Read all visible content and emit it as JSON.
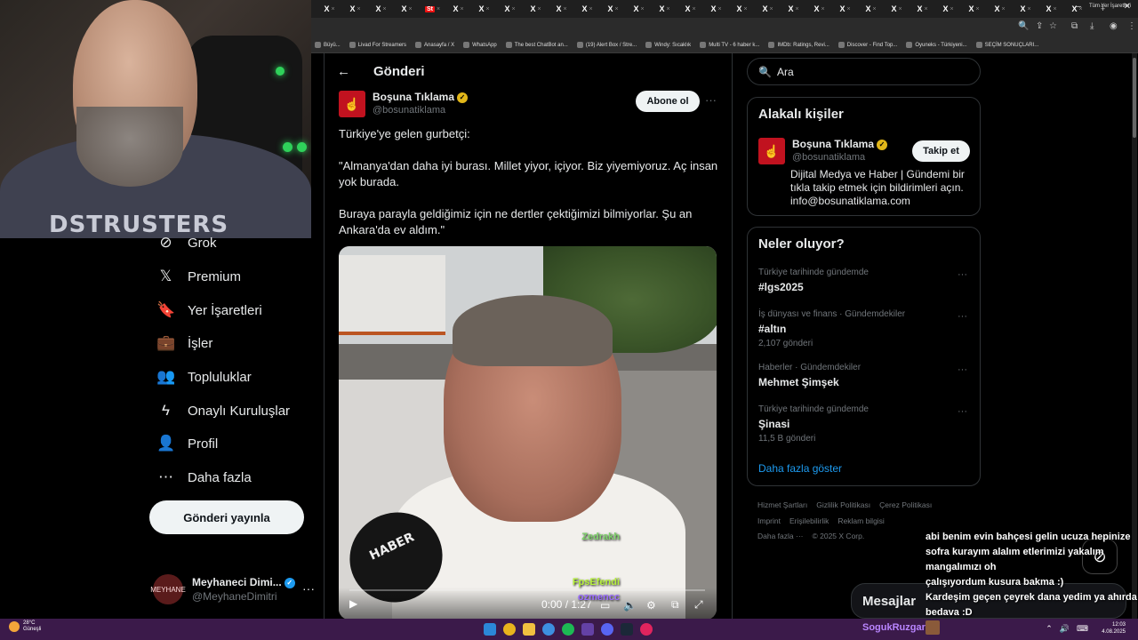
{
  "browser": {
    "tab_icon": "X",
    "tab_close": "×",
    "active_tab_label": "St",
    "new_tab": "+",
    "bookmarks": [
      "Büyü...",
      "Livad For Streamers",
      "Anasayfa / X",
      "WhatsApp",
      "The best ChatBot an...",
      "(19) Alert Box / Stre...",
      "Windy: Sıcaklık",
      "Multi TV - 6 haber k...",
      "IMDb: Ratings, Revi...",
      "Discover - Find Top...",
      "Oyuneks - Türkiyeni...",
      "SEÇİM SONUÇLARI..."
    ],
    "all_bookmarks": "Tüm Yer İşaretleri"
  },
  "webcam": {
    "shirt_text": "DSTRUSTERS"
  },
  "sidebar": {
    "items": [
      {
        "label": "Grok",
        "icon": "grok-icon",
        "glyph": "⊘"
      },
      {
        "label": "Premium",
        "icon": "x-logo-icon",
        "glyph": "𝕏"
      },
      {
        "label": "Yer İşaretleri",
        "icon": "bookmark-icon",
        "glyph": "🔖"
      },
      {
        "label": "İşler",
        "icon": "briefcase-icon",
        "glyph": "💼"
      },
      {
        "label": "Topluluklar",
        "icon": "communities-icon",
        "glyph": "👥"
      },
      {
        "label": "Onaylı Kuruluşlar",
        "icon": "lightning-icon",
        "glyph": "ϟ"
      },
      {
        "label": "Profil",
        "icon": "person-icon",
        "glyph": "👤"
      },
      {
        "label": "Daha fazla",
        "icon": "more-circle-icon",
        "glyph": "⋯"
      }
    ],
    "post_button": "Gönderi yayınla",
    "account": {
      "name": "Meyhaneci Dimi...",
      "handle": "@MeyhaneDimitri",
      "avatar_text": "MEYHANE"
    }
  },
  "post": {
    "header_title": "Gönderi",
    "author_name": "Boşuna Tıklama",
    "author_handle": "@bosunatiklama",
    "subscribe_label": "Abone ol",
    "paragraphs": [
      "Türkiye'ye gelen gurbetçi:",
      "\"Almanya'dan daha iyi burası. Millet yiyor, içiyor. Biz yiyemiyoruz. Aç insan yok burada.",
      "Buraya parayla geldiğimiz için ne dertler çektiğimizi bilmiyorlar. Şu an Ankara'da ev aldım.\""
    ],
    "video": {
      "time": "0:00 / 1:27",
      "mic_label": "HABER",
      "progress": 0
    }
  },
  "right": {
    "search_placeholder": "Ara",
    "relevant_title": "Alakalı kişiler",
    "relevant_person": {
      "name": "Boşuna Tıklama",
      "handle": "@bosunatiklama",
      "bio": "Dijital Medya ve Haber | Gündemi bir tıkla takip etmek için bildirimleri açın. info@bosunatiklama.com",
      "follow_label": "Takip et"
    },
    "trends_title": "Neler oluyor?",
    "trends": [
      {
        "context": "Türkiye tarihinde gündemde",
        "title": "#lgs2025",
        "count": ""
      },
      {
        "context": "İş dünyası ve finans · Gündemdekiler",
        "title": "#altın",
        "count": "2,107 gönderi"
      },
      {
        "context": "Haberler · Gündemdekiler",
        "title": "Mehmet Şimşek",
        "count": ""
      },
      {
        "context": "Türkiye tarihinde gündemde",
        "title": "Şinasi",
        "count": "11,5 B gönderi"
      }
    ],
    "show_more": "Daha fazla göster",
    "footer_links": [
      "Hizmet Şartları",
      "Gizlilik Politikası",
      "Çerez Politikası",
      "Imprint",
      "Erişilebilirlik",
      "Reklam bilgisi",
      "Daha fazla ···",
      "© 2025 X Corp."
    ]
  },
  "chat": {
    "messages": [
      {
        "user": "Zedrakh",
        "color": "#7fd46b",
        "text": "abi benim evin bahçesi gelin ucuza hepinize"
      },
      {
        "user": "",
        "color": "#fff",
        "text": "sofra kurayım alalım etlerimizi yakalım"
      },
      {
        "user": "",
        "color": "#fff",
        "text": "mangalımızı oh"
      },
      {
        "user": "FpsEfendi",
        "color": "#b6f23a",
        "text": "çalışıyordum kusura bakma :)"
      },
      {
        "user": "ozmencc",
        "color": "#9a6bff",
        "text": "Kardeşim geçen çeyrek dana yedim ya ahırda"
      },
      {
        "user": "",
        "color": "#fff",
        "text": "bedava :D"
      }
    ],
    "messages_bar": "Mesajlar",
    "streamer": "SogukRuzgar"
  },
  "taskbar": {
    "weather_temp": "28°C",
    "weather_desc": "Güneşli",
    "time": "12:03",
    "date": "4.08.2025"
  }
}
